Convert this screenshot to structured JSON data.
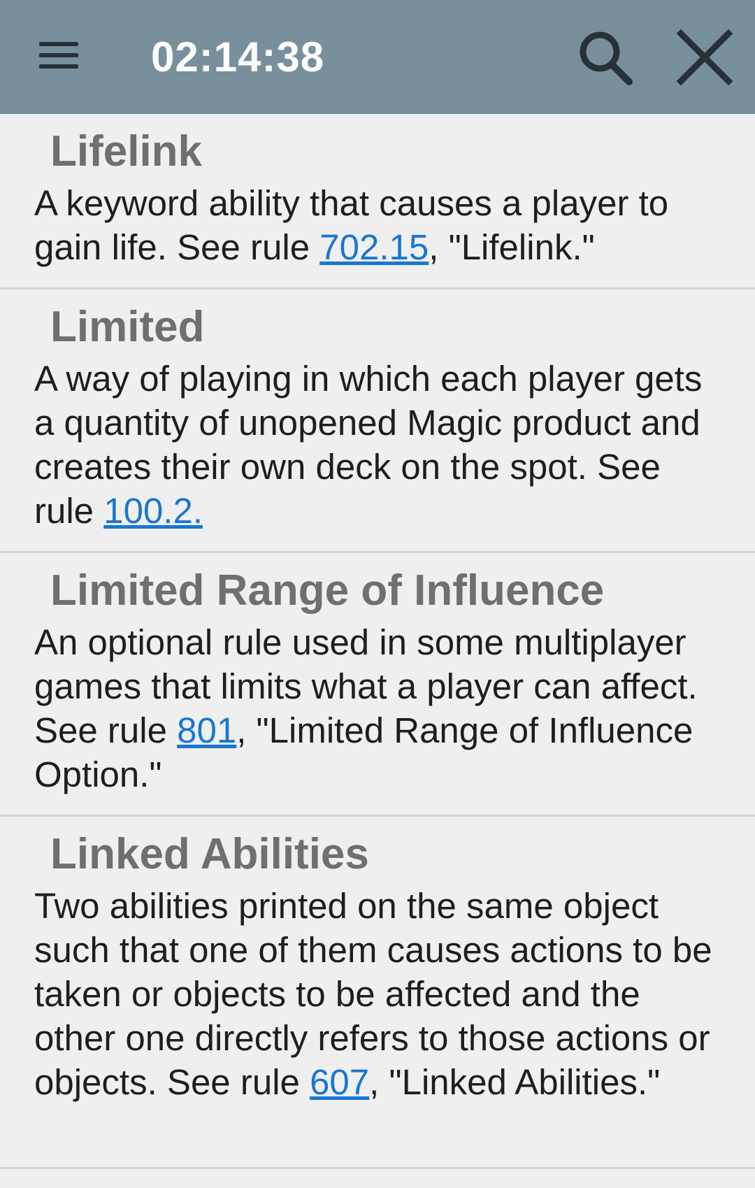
{
  "toolbar": {
    "time": "02:14:38",
    "menu_icon": "hamburger-menu-icon",
    "search_icon": "search-icon",
    "close_icon": "close-icon"
  },
  "entries": [
    {
      "term": "Lifelink",
      "def_before": "A keyword ability that causes a player to gain life. See rule ",
      "link": "702.15",
      "def_after": ", \"Lifelink.\""
    },
    {
      "term": "Limited",
      "def_before": "A way of playing in which each player gets a quantity of unopened Magic product and creates their own deck on the spot. See rule ",
      "link": "100.2.",
      "def_after": ""
    },
    {
      "term": "Limited Range of Influence",
      "def_before": "An optional rule used in some multiplayer games that limits what a player can affect. See rule ",
      "link": "801",
      "def_after": ", \"Limited Range of Influence Option.\""
    },
    {
      "term": "Linked Abilities",
      "def_before": "Two abilities printed on the same object such that one of them causes actions to be taken or objects to be affected and the other one directly refers to those actions or objects. See rule ",
      "link": "607",
      "def_after": ", \"Linked Abilities.\""
    }
  ],
  "colors": {
    "toolbar": "#78909c",
    "background": "#efefef",
    "link": "#1976d2",
    "term": "#6f6f6f"
  }
}
